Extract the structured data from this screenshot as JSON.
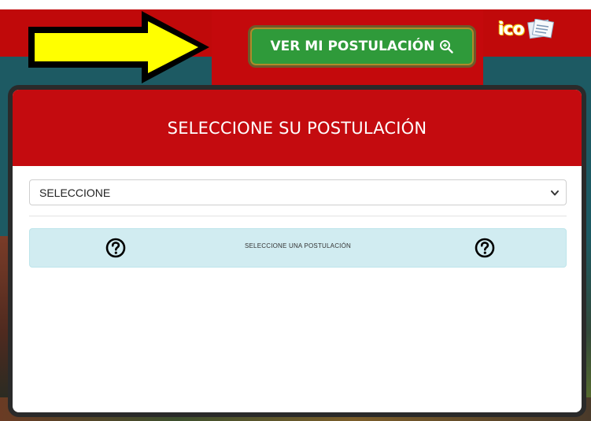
{
  "header": {
    "logo_text": "ico",
    "cta_label": "VER MI POSTULACIÓN"
  },
  "modal": {
    "title": "SELECCIONE SU POSTULACIÓN",
    "select": {
      "selected_value": "SELECCIONE"
    },
    "info": {
      "message": "SELECCIONE UNA POSTULACIÓN"
    }
  },
  "icons": {
    "cta": "magnifier-plus-icon",
    "select": "chevron-down-icon",
    "info_left": "question-circle-icon",
    "info_right": "question-circle-icon",
    "pointer": "arrow-right-icon"
  },
  "colors": {
    "header_red": "#c40b0f",
    "button_green": "#2f9a3a",
    "info_bg": "#d1ecf1",
    "arrow_fill": "#ffff00",
    "background_teal": "#1d5a63"
  }
}
